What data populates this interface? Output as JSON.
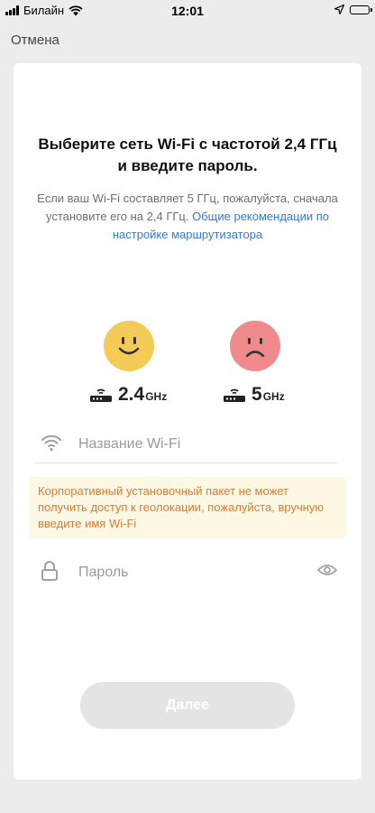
{
  "status_bar": {
    "carrier": "Билайн",
    "time": "12:01"
  },
  "header": {
    "cancel_label": "Отмена"
  },
  "main": {
    "title": "Выберите сеть Wi-Fi с частотой 2,4 ГГц и введите пароль.",
    "description": "Если ваш Wi-Fi составляет 5 ГГц, пожалуйста, сначала установите его на 2,4 ГГц.",
    "description_link": "Общие рекомендации по настройке маршрутизатора",
    "freq_24": {
      "value": "2.4",
      "unit": "GHz"
    },
    "freq_5": {
      "value": "5",
      "unit": "GHz"
    },
    "wifi_placeholder": "Название Wi-Fi",
    "warning": "Корпоративный установочный пакет не может получить доступ к геолокации, пожалуйста, вручную введите имя Wi-Fi",
    "password_placeholder": "Пароль",
    "next_label": "Далее"
  },
  "colors": {
    "link": "#2c7be5",
    "warning_text": "#e07a2e",
    "warning_bg": "#fdf8e3",
    "happy_face": "#f5cb58",
    "sad_face": "#f08a8d",
    "button_disabled": "#e4e4e4"
  },
  "icons": [
    "signal-icon",
    "wifi-status-icon",
    "location-icon",
    "battery-icon",
    "router-icon",
    "wifi-icon",
    "lock-icon",
    "eye-icon",
    "happy-face-icon",
    "sad-face-icon"
  ]
}
